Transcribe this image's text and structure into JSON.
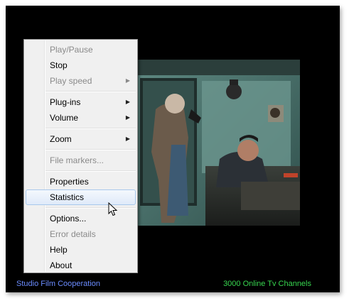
{
  "player": {
    "status_left": "Studio Film Cooperation",
    "status_right": "3000 Online Tv Channels"
  },
  "colors": {
    "window_bg": "#000000",
    "status_left": "#6b8cff",
    "status_right": "#37d64f",
    "menu_bg": "#f0f0f0",
    "menu_hover": "#dfeaf9"
  },
  "menu": {
    "items": [
      {
        "label": "Play/Pause",
        "disabled": true,
        "submenu": false
      },
      {
        "label": "Stop",
        "disabled": false,
        "submenu": false
      },
      {
        "label": "Play speed",
        "disabled": true,
        "submenu": true
      },
      {
        "label": "Plug-ins",
        "disabled": false,
        "submenu": true
      },
      {
        "label": "Volume",
        "disabled": false,
        "submenu": true
      },
      {
        "label": "Zoom",
        "disabled": false,
        "submenu": true
      },
      {
        "label": "File markers...",
        "disabled": true,
        "submenu": false
      },
      {
        "label": "Properties",
        "disabled": false,
        "submenu": false
      },
      {
        "label": "Statistics",
        "disabled": false,
        "submenu": false,
        "hovered": true
      },
      {
        "label": "Options...",
        "disabled": false,
        "submenu": false
      },
      {
        "label": "Error details",
        "disabled": true,
        "submenu": false
      },
      {
        "label": "Help",
        "disabled": false,
        "submenu": false
      },
      {
        "label": "About",
        "disabled": false,
        "submenu": false
      }
    ],
    "submenu_arrow": "▶"
  },
  "icons": {
    "cursor": "arrow-cursor-icon"
  }
}
